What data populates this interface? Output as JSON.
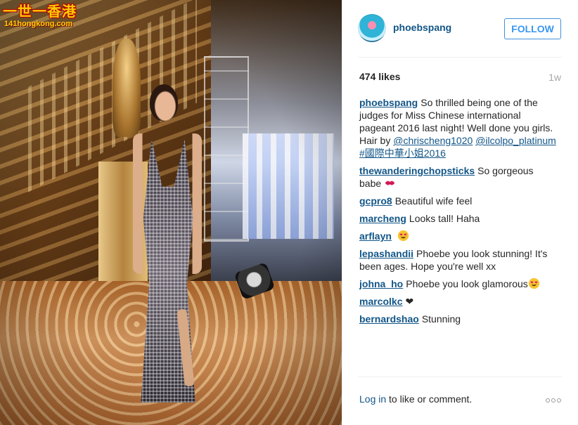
{
  "watermark": {
    "cn_text": "一世一香港",
    "url_text": "141hongkong.com"
  },
  "header": {
    "username": "phoebspang",
    "follow_label": "FOLLOW"
  },
  "stats": {
    "likes": "474 likes",
    "time": "1w"
  },
  "caption": {
    "user": "phoebspang",
    "text_1": "So thrilled being one of the judges for Miss Chinese international pageant 2016 last night! Well done you girls. Hair by ",
    "mention_1": "@chrischeng1020",
    "mention_2": "@ilcolpo_platinum",
    "hashtag": "#國際中華小姐2016"
  },
  "comments": [
    {
      "user": "thewanderingchopsticks",
      "text": "So gorgeous babe",
      "emoji": "kiss-mark-icon"
    },
    {
      "user": "gcpro8",
      "text": "Beautiful wife feel"
    },
    {
      "user": "marcheng",
      "text": "Looks tall! Haha"
    },
    {
      "user": "arflayn",
      "text": "",
      "emoji": "heart-eyes-icon"
    },
    {
      "user": "lepashandii",
      "text": "Phoebe you look stunning! It's been ages. Hope you're well xx"
    },
    {
      "user": "johna_ho",
      "text": "Phoebe you look glamorous",
      "emoji": "heart-eyes-icon"
    },
    {
      "user": "marcolkc",
      "text": "❤"
    },
    {
      "user": "bernardshao",
      "text": "Stunning"
    }
  ],
  "footer": {
    "login_label": "Log in",
    "login_suffix": " to like or comment."
  },
  "colors": {
    "username": "#125688",
    "follow": "#3897f0",
    "muted": "#a5a7aa"
  }
}
